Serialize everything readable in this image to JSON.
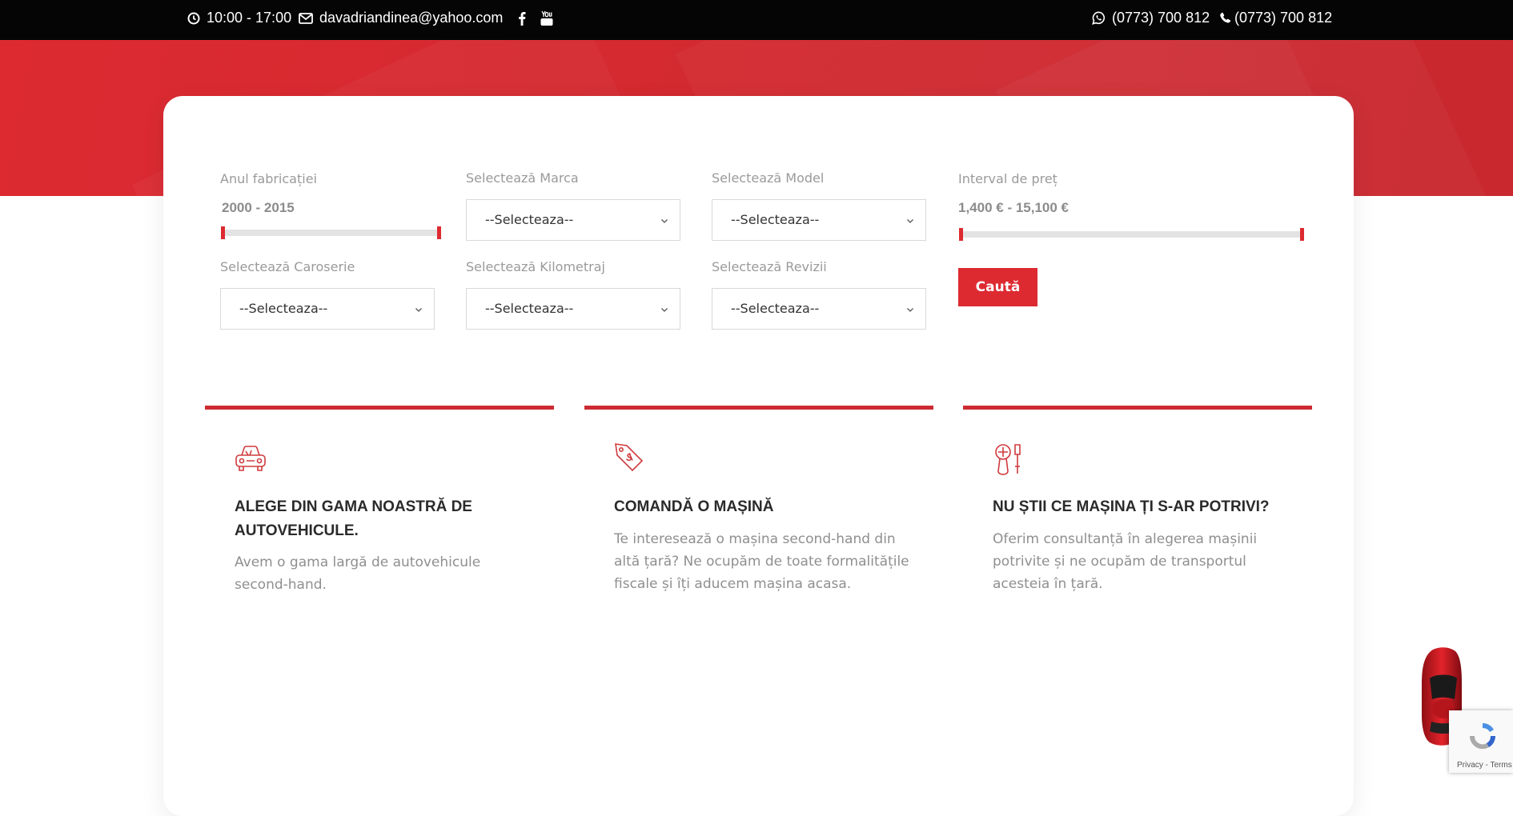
{
  "topbar": {
    "hours": "10:00 - 17:00",
    "email": "davadriandinea@yahoo.com",
    "whatsapp": "(0773) 700 812",
    "phone": "(0773) 700 812"
  },
  "search": {
    "year": {
      "label": "Anul fabricației",
      "value": "2000 - 2015",
      "min": 2000,
      "max": 2015
    },
    "brand": {
      "label": "Selectează Marca",
      "selected": "--Selecteaza--"
    },
    "model": {
      "label": "Selectează Model",
      "selected": "--Selecteaza--"
    },
    "price": {
      "label": "Interval de preț",
      "value": "1,400 € - 15,100 €",
      "min": 1400,
      "max": 15100
    },
    "body": {
      "label": "Selectează Caroserie",
      "selected": "--Selecteaza--"
    },
    "mileage": {
      "label": "Selectează Kilometraj",
      "selected": "--Selecteaza--"
    },
    "revisions": {
      "label": "Selectează Revizii",
      "selected": "--Selecteaza--"
    },
    "submit_label": "Caută"
  },
  "features": [
    {
      "icon": "car-icon",
      "title": "ALEGE DIN GAMA NOASTRĂ DE AUTOVEHICULE.",
      "text": "Avem o gama largă de autovehicule second-hand."
    },
    {
      "icon": "price-tag-icon",
      "title": "COMANDĂ O MAȘINĂ",
      "text": "Te interesează o mașina second-hand din altă țară? Ne ocupăm de toate formalitățile fiscale și îți aducem mașina acasa."
    },
    {
      "icon": "tools-icon",
      "title": "NU ȘTII CE MAȘINA ȚI S-AR POTRIVI?",
      "text": "Oferim consultanță în alegerea mașinii potrivite și ne ocupăm de transportul acesteia în țară."
    }
  ],
  "recaptcha": {
    "text": "Privacy - Terms"
  },
  "colors": {
    "accent": "#dd2a31",
    "topbar": "#050505"
  }
}
